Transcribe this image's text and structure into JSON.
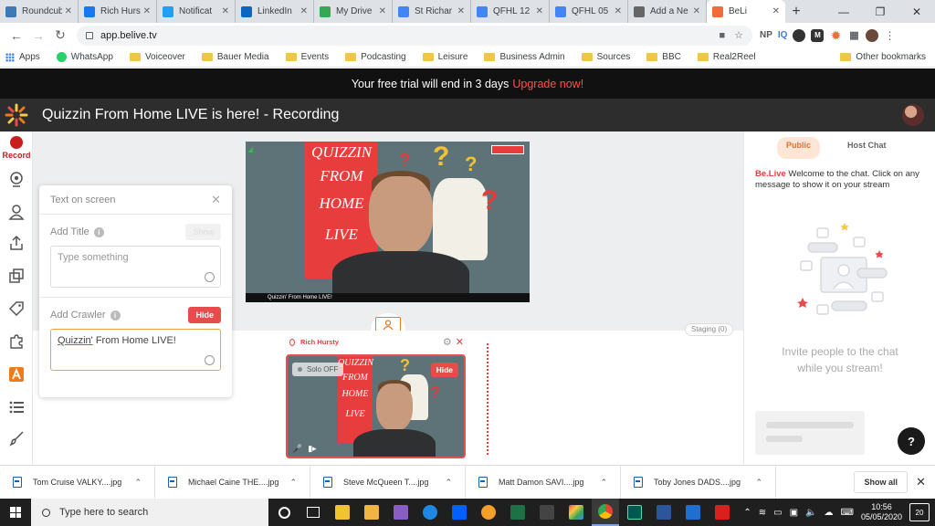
{
  "browser": {
    "tabs": [
      {
        "label": "Roundcub",
        "color": "#3d7ab8",
        "icon": "roundcube-icon"
      },
      {
        "label": "Rich Hurs",
        "color": "#1877f2",
        "icon": "facebook-icon"
      },
      {
        "label": "Notificat",
        "color": "#1da1f2",
        "icon": "twitter-icon"
      },
      {
        "label": "LinkedIn",
        "color": "#0a66c2",
        "icon": "linkedin-icon"
      },
      {
        "label": "My Drive",
        "color": "#34a853",
        "icon": "google-drive-icon"
      },
      {
        "label": "St Richar",
        "color": "#4285f4",
        "icon": "google-docs-icon"
      },
      {
        "label": "QFHL 12",
        "color": "#4285f4",
        "icon": "google-docs-icon"
      },
      {
        "label": "QFHL 05",
        "color": "#4285f4",
        "icon": "google-docs-icon"
      },
      {
        "label": "Add a Ne",
        "color": "#666666",
        "icon": "globe-icon"
      },
      {
        "label": "BeLi",
        "color": "#f26b3a",
        "icon": "belive-icon",
        "active": true
      }
    ],
    "url": "app.belive.tv",
    "bookmarks": [
      {
        "label": "Apps",
        "kind": "apps"
      },
      {
        "label": "WhatsApp",
        "kind": "whatsapp"
      },
      {
        "label": "Voiceover",
        "kind": "folder"
      },
      {
        "label": "Bauer Media",
        "kind": "folder"
      },
      {
        "label": "Events",
        "kind": "folder"
      },
      {
        "label": "Podcasting",
        "kind": "folder"
      },
      {
        "label": "Leisure",
        "kind": "folder"
      },
      {
        "label": "Business Admin",
        "kind": "folder"
      },
      {
        "label": "Sources",
        "kind": "folder"
      },
      {
        "label": "BBC",
        "kind": "folder"
      },
      {
        "label": "Real2Reel",
        "kind": "folder"
      }
    ],
    "other_bookmarks": "Other bookmarks",
    "extensions": [
      "NP",
      "IQ"
    ]
  },
  "trial": {
    "text": "Your free trial will end in 3 days",
    "link": "Upgrade now!"
  },
  "app": {
    "title": "Quizzin From Home LIVE is here! - Recording"
  },
  "sidebar": {
    "record_label": "Record"
  },
  "video": {
    "poster_lines": [
      "QUIZZIN",
      "FROM",
      "HOME",
      "LIVE"
    ],
    "caption": "Quizzin' From Home LIVE!"
  },
  "staging": {
    "label": "Staging (0)"
  },
  "guest": {
    "name": "Rich Hursty",
    "solo_label": "Solo OFF",
    "hide_label": "Hide",
    "poster_lines": [
      "QUIZZIN",
      "FROM",
      "HOME",
      "LIVE"
    ]
  },
  "text_panel": {
    "title": "Text on screen",
    "add_title_label": "Add Title",
    "show_label": "Show",
    "title_placeholder": "Type something",
    "add_crawler_label": "Add Crawler",
    "crawler_hide_label": "Hide",
    "crawler_word1": "Quizzin'",
    "crawler_rest": " From Home LIVE!"
  },
  "chat": {
    "tab_public": "Public",
    "tab_host": "Host Chat",
    "brand": "Be.Live",
    "welcome": " Welcome to the chat. Click on any message to show it on your stream",
    "empty_line1": "Invite people to the chat",
    "empty_line2": "while you stream!",
    "help": "?"
  },
  "downloads": {
    "items": [
      "Tom Cruise VALKY....jpg",
      "Michael Caine THE....jpg",
      "Steve McQueen T....jpg",
      "Matt Damon SAVI....jpg",
      "Toby Jones DADS....jpg"
    ],
    "show_all": "Show all"
  },
  "taskbar": {
    "search_placeholder": "Type here to search",
    "time": "10:56",
    "date": "05/05/2020",
    "notifications": "20"
  },
  "colors": {
    "accent": "#e84b4b",
    "brand_orange": "#f07a1a",
    "trial_link": "#ff4f4f"
  }
}
